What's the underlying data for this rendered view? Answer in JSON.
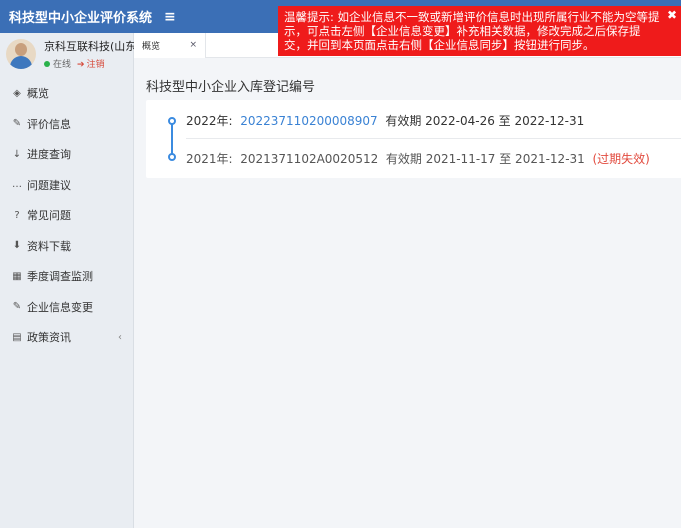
{
  "app": {
    "title": "科技型中小企业评价系统",
    "menu_toggle": "≡"
  },
  "user": {
    "name": "京科互联科技(山东)有",
    "status": "在线",
    "logout": "注销"
  },
  "nav": {
    "items": [
      {
        "label": "概览",
        "icon": "layers-icon"
      },
      {
        "label": "评价信息",
        "icon": "edit-icon"
      },
      {
        "label": "进度查询",
        "icon": "sort-icon"
      },
      {
        "label": "问题建议",
        "icon": "chat-icon"
      },
      {
        "label": "常见问题",
        "icon": "question-icon"
      },
      {
        "label": "资料下载",
        "icon": "download-icon"
      },
      {
        "label": "季度调查监测",
        "icon": "grid-icon"
      },
      {
        "label": "企业信息变更",
        "icon": "edit-icon"
      },
      {
        "label": "政策资讯",
        "icon": "newspaper-icon"
      }
    ],
    "collapse_caret": "‹"
  },
  "tabs": [
    {
      "label": "概览",
      "close": "×"
    }
  ],
  "main": {
    "section_title": "科技型中小企业入库登记编号",
    "records": [
      {
        "year": "2022年:",
        "code": "202237110200008907",
        "valid_text": "有效期 2022-04-26 至 2022-12-31",
        "expired": ""
      },
      {
        "year": "2021年:",
        "code": "2021371102A0020512",
        "valid_text": "有效期 2021-11-17 至 2021-12-31",
        "expired": "(过期失效)"
      }
    ]
  },
  "alert": {
    "text": "温馨提示: 如企业信息不一致或新增评价信息时出现所属行业不能为空等提示，可点击左侧【企业信息变更】补充相关数据，修改完成之后保存提交，并回到本页面点击右侧【企业信息同步】按钮进行同步。",
    "close": "✖"
  },
  "colors": {
    "brand": "#3b6fb6",
    "alert": "#ef1b1b",
    "link": "#3a82d4",
    "expired": "#e24b3f",
    "online": "#2ab24b"
  }
}
